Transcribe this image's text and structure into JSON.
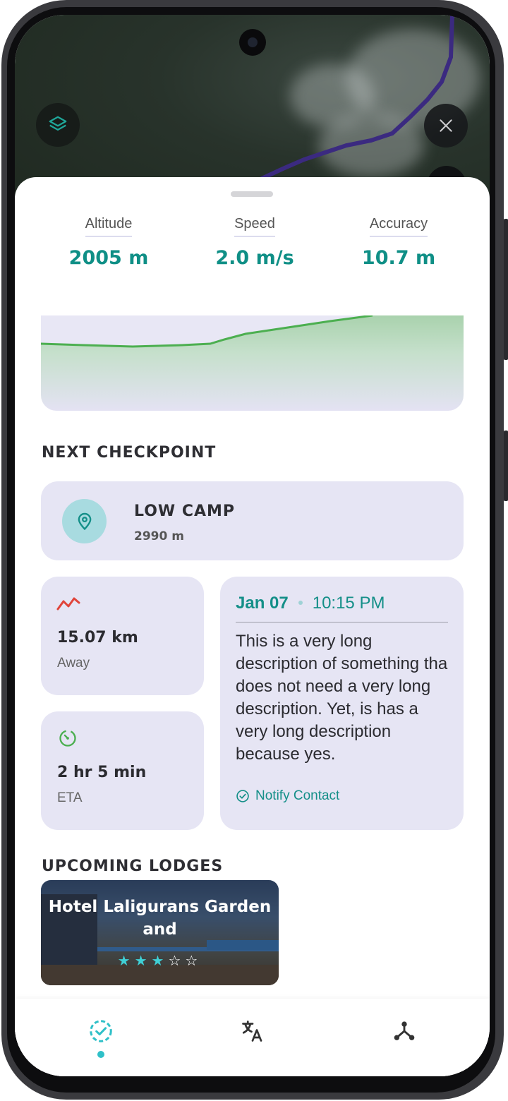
{
  "map": {
    "layers_icon": "layers-icon",
    "close_icon": "close-icon"
  },
  "stats": [
    {
      "label": "Altitude",
      "value": "2005 m"
    },
    {
      "label": "Speed",
      "value": "2.0 m/s"
    },
    {
      "label": "Accuracy",
      "value": "10.7 m"
    }
  ],
  "next_checkpoint": {
    "section_title": "NEXT CHECKPOINT",
    "name": "LOW CAMP",
    "altitude": "2990 m",
    "icon": "map-pin-icon"
  },
  "distance": {
    "value": "15.07 km",
    "label": "Away",
    "icon": "trend-line-icon"
  },
  "eta": {
    "value": "2 hr 5 min",
    "label": "ETA",
    "icon": "timer-icon"
  },
  "note": {
    "date": "Jan 07",
    "time": "10:15 PM",
    "body": "This is a very long description of something tha does not need a very long description. Yet, is has a very long description because yes.",
    "action": "Notify Contact"
  },
  "upcoming_lodges": {
    "section_title": "UPCOMING LODGES",
    "items": [
      {
        "name": "Hotel Laligurans Garden and",
        "rating": 3,
        "max_rating": 5
      }
    ]
  },
  "bottom_nav": [
    {
      "name": "progress",
      "icon": "check-progress-icon",
      "active": true
    },
    {
      "name": "translate",
      "icon": "translate-icon",
      "active": false
    },
    {
      "name": "share",
      "icon": "share-network-icon",
      "active": false
    }
  ],
  "colors": {
    "accent": "#0f8f86",
    "card_bg": "#e6e5f4",
    "route": "#3b2a80",
    "chart_line": "#4caf50"
  }
}
